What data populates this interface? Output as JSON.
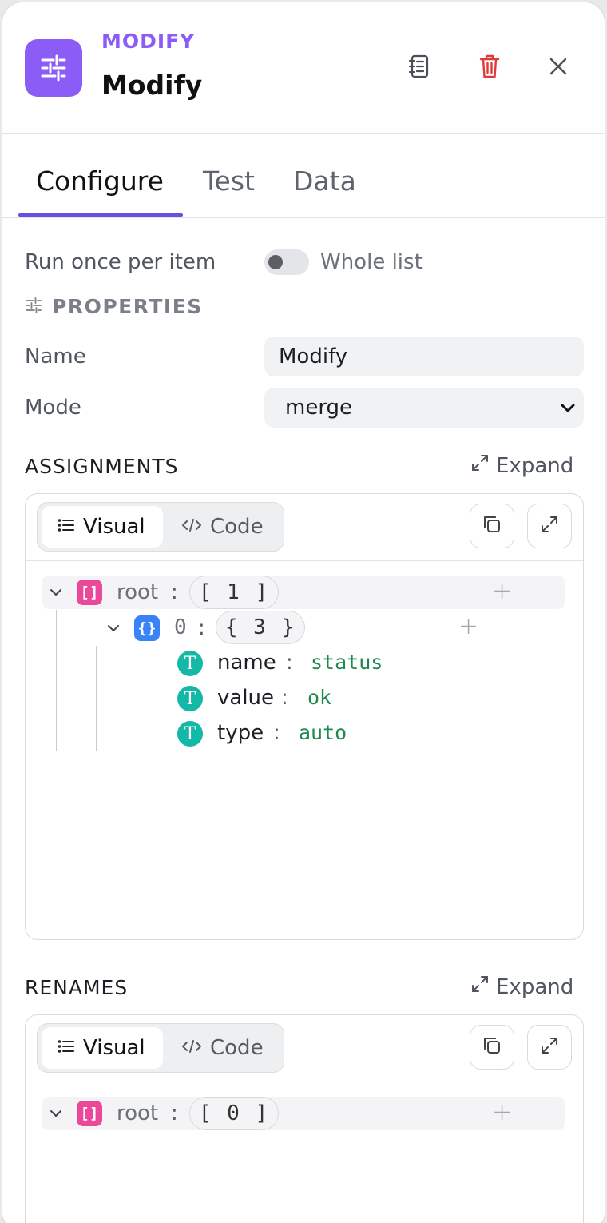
{
  "header": {
    "eyebrow": "MODIFY",
    "title": "Modify",
    "accent_color": "#8b5cf6",
    "icons": {
      "app": "sliders-icon",
      "docs": "notebook-icon",
      "delete": "trash-icon",
      "close": "close-icon"
    }
  },
  "tabs": [
    {
      "label": "Configure",
      "active": true
    },
    {
      "label": "Test",
      "active": false
    },
    {
      "label": "Data",
      "active": false
    }
  ],
  "run_mode": {
    "label": "Run once per item",
    "toggle_label": "Whole list",
    "toggle_on": false
  },
  "properties": {
    "heading": "PROPERTIES",
    "name": {
      "label": "Name",
      "value": "Modify"
    },
    "mode": {
      "label": "Mode",
      "value": "merge"
    }
  },
  "assignments": {
    "title": "ASSIGNMENTS",
    "expand_label": "Expand",
    "view_visual": "Visual",
    "view_code": "Code",
    "tree": {
      "root_key": "root",
      "root_count": "[ 1 ]",
      "item_key": "0",
      "item_count": "{ 3 }",
      "fields": [
        {
          "key": "name",
          "value": "status"
        },
        {
          "key": "value",
          "value": "ok"
        },
        {
          "key": "type",
          "value": "auto"
        }
      ]
    }
  },
  "renames": {
    "title": "RENAMES",
    "expand_label": "Expand",
    "view_visual": "Visual",
    "view_code": "Code",
    "tree": {
      "root_key": "root",
      "root_count": "[ 0 ]"
    }
  },
  "colors": {
    "array_badge": "#ec4899",
    "object_badge": "#3b82f6",
    "string_badge": "#14b8a6",
    "string_value": "#1e8a4e",
    "delete_icon": "#e03a3a"
  }
}
